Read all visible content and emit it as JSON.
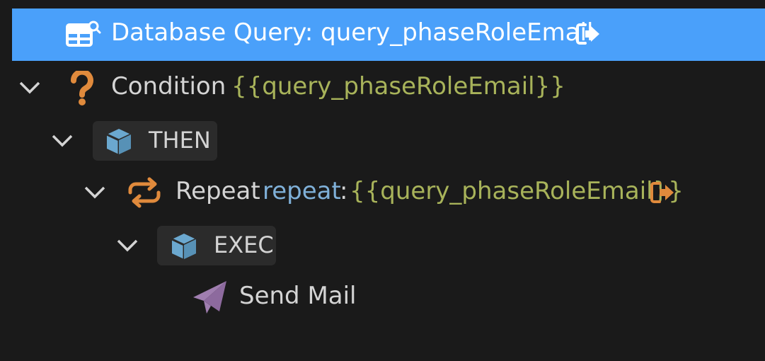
{
  "tree": {
    "db_query": {
      "icon": "table-search-icon",
      "label": "Database Query: query_phaseRoleEmail",
      "action_icon": "sign-out-icon"
    },
    "condition": {
      "icon": "question-mark-icon",
      "label": "Condition",
      "expression": "{{query_phaseRoleEmail}}"
    },
    "then_block": {
      "icon": "cube-icon",
      "label": "THEN"
    },
    "repeat": {
      "icon": "repeat-icon",
      "label": "Repeat",
      "keyword": "repeat",
      "colon": ":",
      "expression": "{{query_phaseRoleEmail}}",
      "action_icon": "sign-out-icon"
    },
    "exec_block": {
      "icon": "cube-icon",
      "label": "EXEC"
    },
    "send_mail": {
      "icon": "paper-plane-icon",
      "label": "Send Mail"
    }
  },
  "colors": {
    "background": "#1a1a1a",
    "selection": "#4aa0fa",
    "text": "#d4d4d4",
    "keyword": "#7fb0d8",
    "expression": "#a8b35a",
    "orange_icon": "#e08a3c",
    "cube": "#6ba8cf",
    "send_mail": "#a07eb0"
  }
}
